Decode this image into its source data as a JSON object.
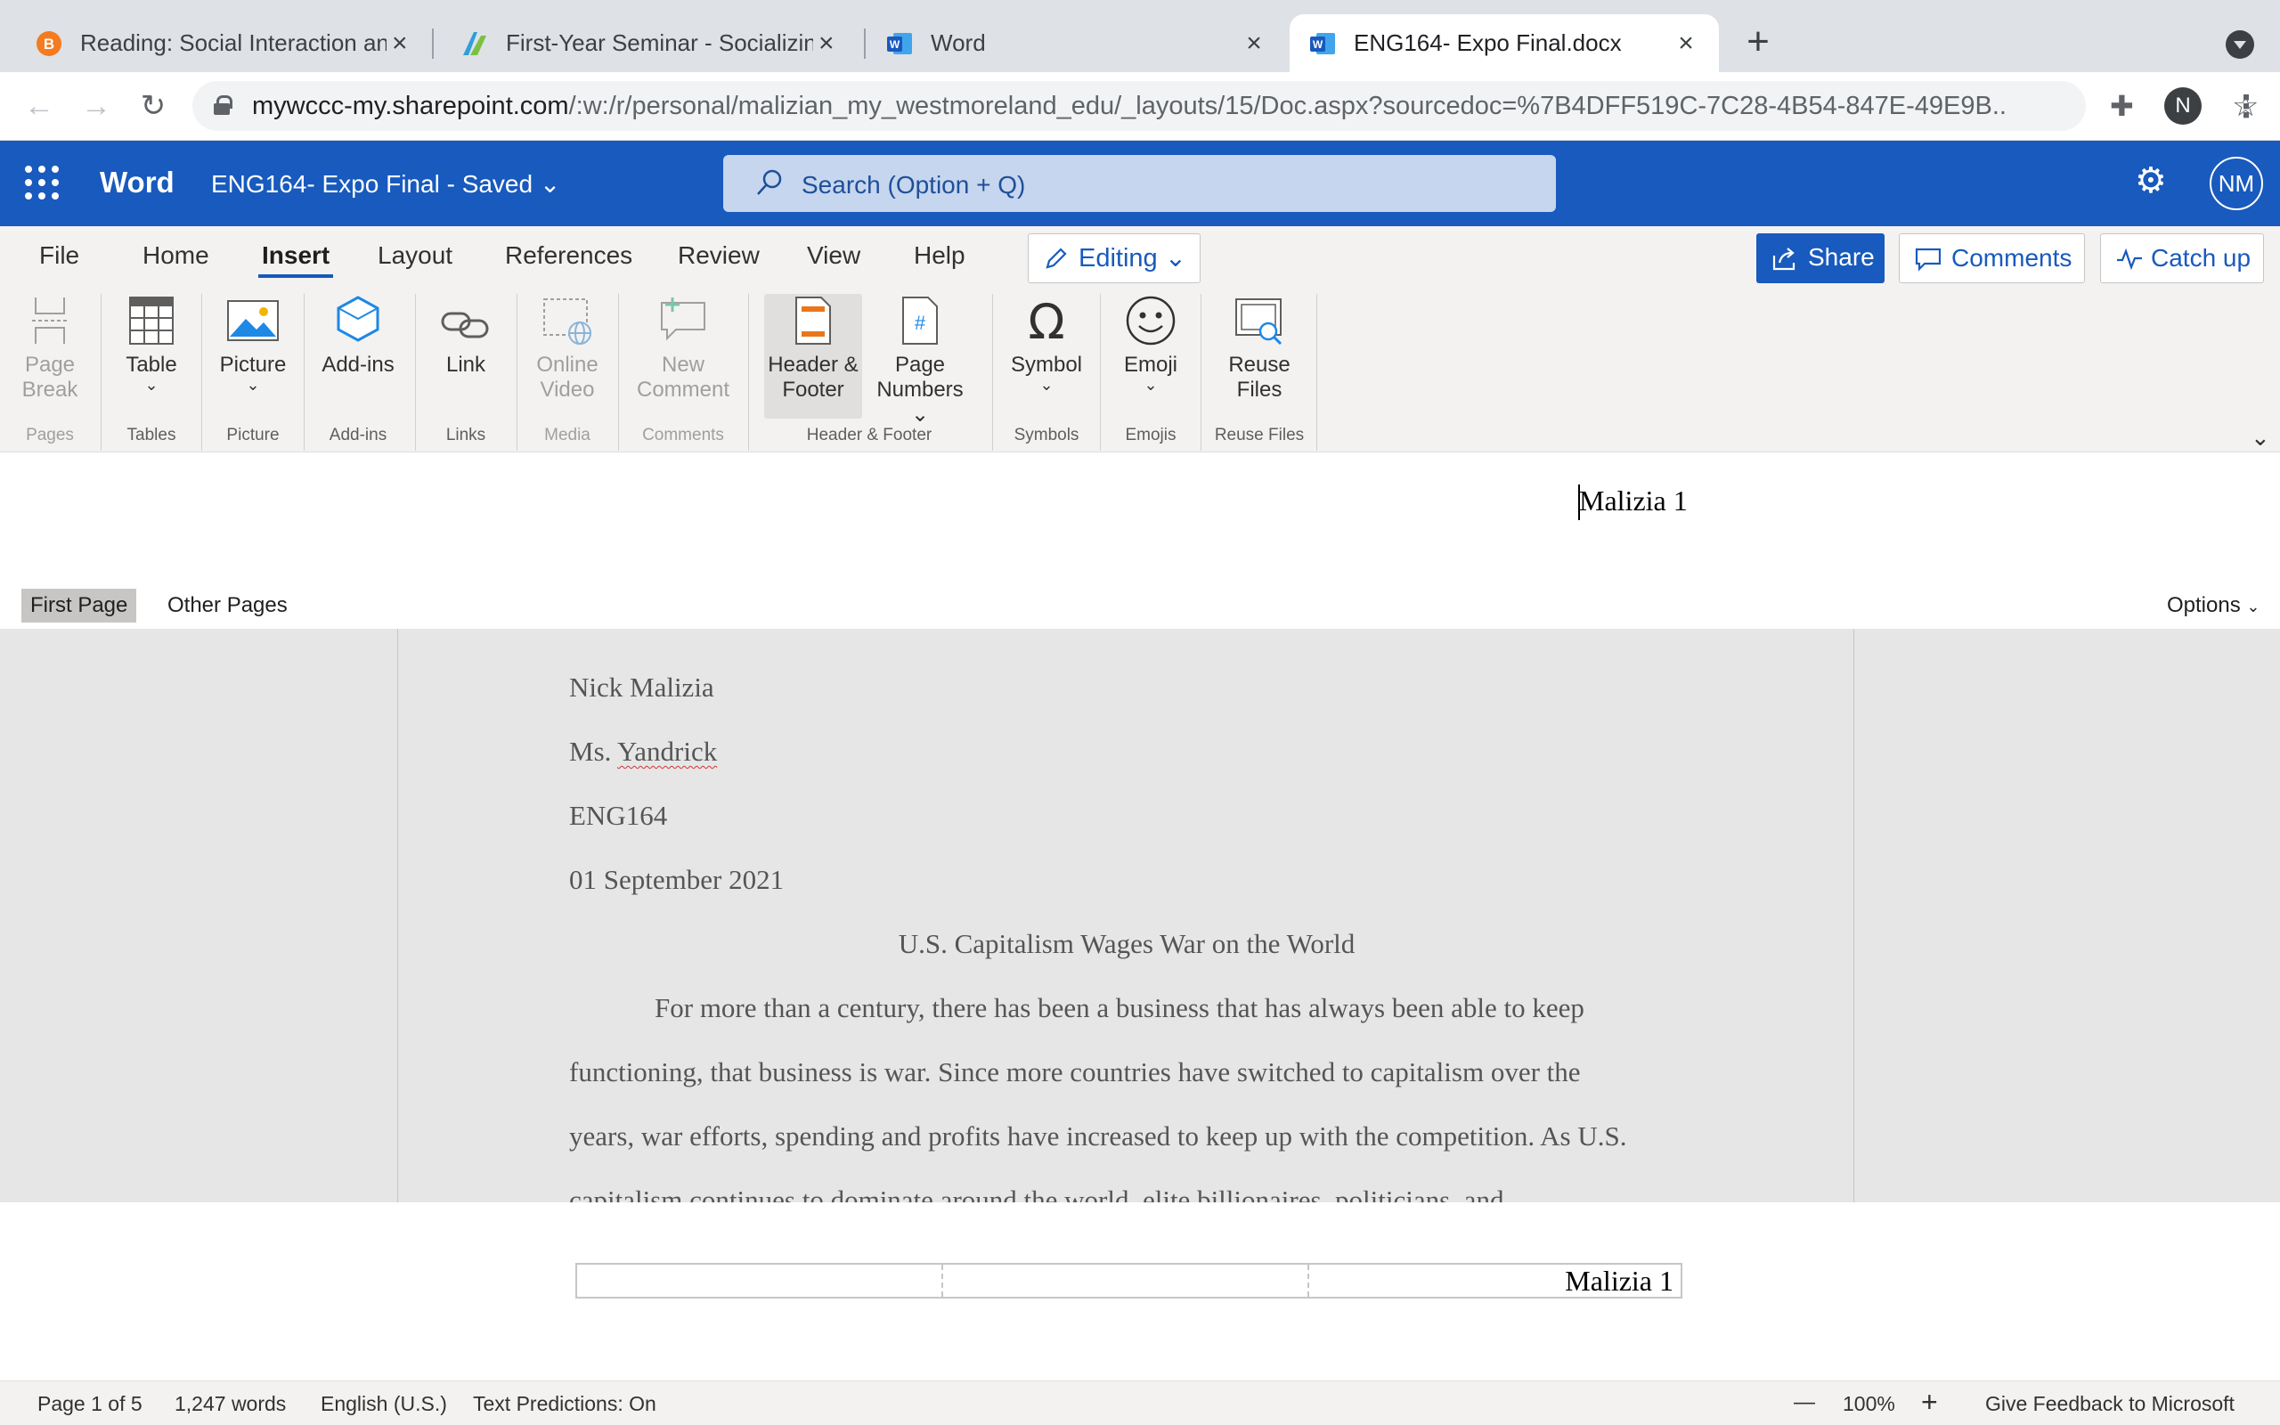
{
  "browser": {
    "tabs": [
      {
        "title": "Reading: Social Interaction and",
        "icon": "reading-favicon-icon"
      },
      {
        "title": "First-Year Seminar - Socializing",
        "icon": "seminar-favicon-icon"
      },
      {
        "title": "Word",
        "icon": "word-favicon-icon"
      },
      {
        "title": "ENG164- Expo Final.docx",
        "icon": "word-favicon-icon"
      }
    ],
    "url_host": "mywccc-my.sharepoint.com",
    "url_path": "/:w:/r/personal/malizian_my_westmoreland_edu/_layouts/15/Doc.aspx?sourcedoc=%7B4DFF519C-7C28-4B54-847E-49E9B...",
    "profile_initial": "N"
  },
  "word": {
    "app_name": "Word",
    "doc_title": "ENG164- Expo Final",
    "save_status": "Saved",
    "search_placeholder": "Search (Option + Q)",
    "avatar": "NM",
    "brand_color": "#185abd"
  },
  "ribbon_tabs": [
    "File",
    "Home",
    "Insert",
    "Layout",
    "References",
    "Review",
    "View",
    "Help"
  ],
  "active_ribbon_tab": "Insert",
  "editing_label": "Editing",
  "share_label": "Share",
  "comments_label": "Comments",
  "catchup_label": "Catch up",
  "ribbon": {
    "page_break": {
      "line1": "Page",
      "line2": "Break"
    },
    "table": "Table",
    "picture": "Picture",
    "addins": "Add-ins",
    "link": "Link",
    "online_video": {
      "line1": "Online",
      "line2": "Video"
    },
    "new_comment": {
      "line1": "New",
      "line2": "Comment"
    },
    "header_footer": {
      "line1": "Header &",
      "line2": "Footer"
    },
    "page_numbers": {
      "line1": "Page",
      "line2": "Numbers"
    },
    "symbol": "Symbol",
    "emoji": "Emoji",
    "reuse_files": {
      "line1": "Reuse",
      "line2": "Files"
    },
    "groups": {
      "pages": "Pages",
      "tables": "Tables",
      "picture": "Picture",
      "addins": "Add-ins",
      "links": "Links",
      "media": "Media",
      "comments": "Comments",
      "header_footer": "Header & Footer",
      "symbols": "Symbols",
      "emojis": "Emojis",
      "reuse_files": "Reuse Files"
    }
  },
  "header": {
    "text": "Malizia 1",
    "first_page": "First Page",
    "other_pages": "Other Pages",
    "options": "Options"
  },
  "document": {
    "lines": [
      "Nick Malizia",
      "Ms. ",
      "Yandrick",
      "ENG164",
      "01 September 2021",
      "U.S. Capitalism Wages War on the World",
      "For more than a century, there has been a business that has always been able to keep",
      "functioning, that business is war. Since more countries have switched to capitalism over the",
      "years, war efforts, spending and profits have increased to keep up with the competition. As U.S.",
      "capitalism continues to dominate around the world, elite billionaires, politicians, and"
    ]
  },
  "footer": {
    "text": "Malizia 1"
  },
  "status": {
    "page": "Page 1 of 5",
    "words": "1,247 words",
    "language": "English (U.S.)",
    "predictions": "Text Predictions: On",
    "zoom_minus": "—",
    "zoom": "100%",
    "zoom_plus": "+",
    "feedback": "Give Feedback to Microsoft"
  }
}
